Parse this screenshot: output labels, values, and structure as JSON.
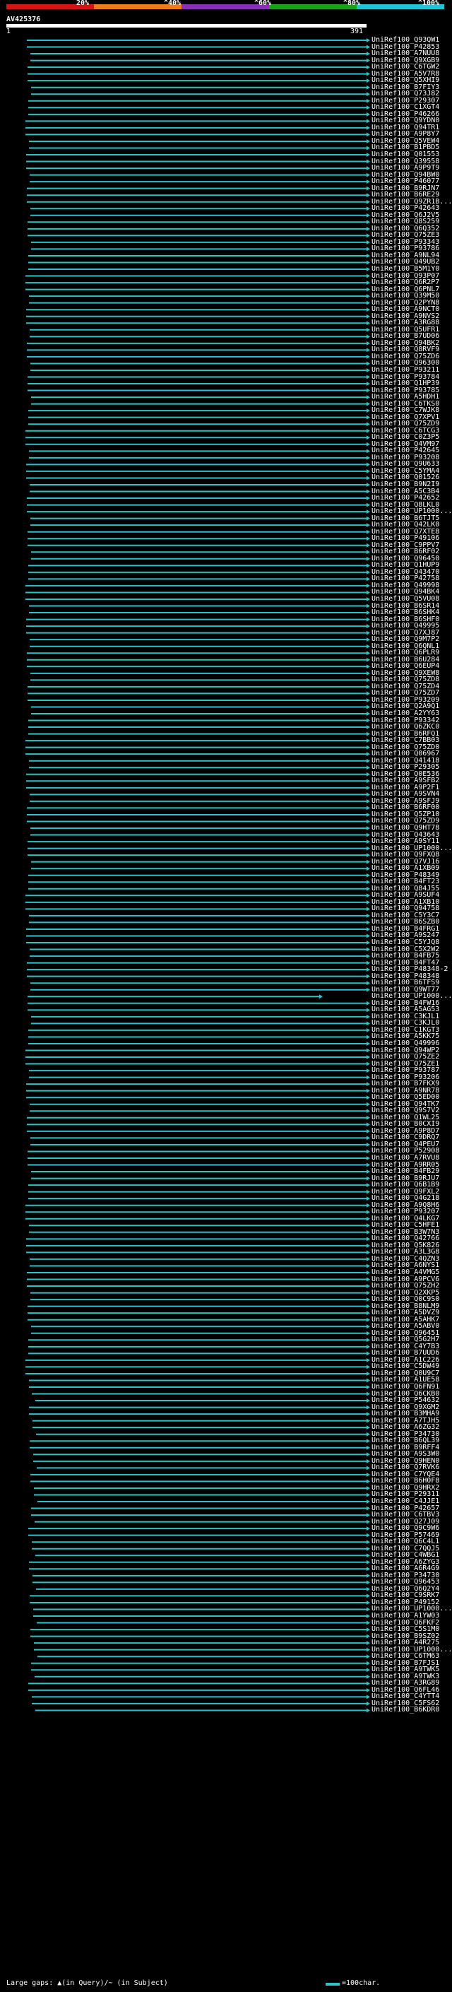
{
  "scale": {
    "labels": [
      "20%",
      "^40%",
      "^60%",
      "^80%",
      "^100%"
    ],
    "colors": [
      "#d61414",
      "#f07c1c",
      "#8a2fb8",
      "#1aa31a",
      "#21c3d9"
    ]
  },
  "query": {
    "title": "AV425376",
    "start": "1",
    "end": "391"
  },
  "hit_color": "#2bc3c8",
  "special_hit_color": "#2a9a1e",
  "hits": [
    "UniRef100_Q93QW1",
    "UniRef100_P42853",
    "UniRef100_A7NUU8",
    "UniRef100_Q9XGB9",
    "UniRef100_C6TGW2",
    "UniRef100_A5V7R8",
    "UniRef100_Q5XHI9",
    "UniRef100_B7FIY3",
    "UniRef100_Q73J82",
    "UniRef100_P29307",
    "UniRef100_C1XGT4",
    "UniRef100_P46266",
    "UniRef100_Q9YDN0",
    "UniRef100_Q94TR1",
    "UniRef100_A9P8Y7",
    "UniRef100_Q5VEW4",
    "UniRef100_B1PBD5",
    "UniRef100_Q01553",
    "UniRef100_Q39558",
    "UniRef100_A9P9T9",
    "UniRef100_Q94BW0",
    "UniRef100_P46077",
    "UniRef100_B9RJN7",
    "UniRef100_B6RE29",
    "UniRef100_Q9ZR1B...",
    "UniRef100_P42643",
    "UniRef100_Q6J2V5",
    "UniRef100_Q8S259",
    "UniRef100_Q6Q352",
    "UniRef100_Q75ZE3",
    "UniRef100_P93343",
    "UniRef100_P93786",
    "UniRef100_A9NL94",
    "UniRef100_Q49UB2",
    "UniRef100_B5M1Y0",
    "UniRef100_Q93P07",
    "UniRef100_Q6R2P7",
    "UniRef100_Q6PNL7",
    "UniRef100_Q39M50",
    "UniRef100_Q2PYN8",
    "UniRef100_A9NCT0",
    "UniRef100_A9NVS2",
    "UniRef100_A3RG88",
    "UniRef100_Q5UFR1",
    "UniRef100_B7UD06",
    "UniRef100_Q94BK2",
    "UniRef100_Q8RVF9",
    "UniRef100_Q75ZD6",
    "UniRef100_Q96300",
    "UniRef100_P93211",
    "UniRef100_P93784",
    "UniRef100_Q1HP39",
    "UniRef100_P93785",
    "UniRef100_A5HDH1",
    "UniRef100_C6TKS0",
    "UniRef100_C7WJK8",
    "UniRef100_Q7XPV1",
    "UniRef100_Q75ZD9",
    "UniRef100_C6TCG3",
    "UniRef100_C0Z3P5",
    "UniRef100_Q4VM97",
    "UniRef100_P42645",
    "UniRef100_P93208",
    "UniRef100_Q9U633",
    "UniRef100_C5YMA4",
    "UniRef100_Q01526",
    "UniRef100_B9N2I9",
    "UniRef100_A5C3B4",
    "UniRef100_P42652",
    "UniRef100_Q8LKL0",
    "UniRef100_UP1000...",
    "UniRef100_B6TJT5",
    "UniRef100_Q42LK0",
    "UniRef100_Q7XTE8",
    "UniRef100_P49106",
    "UniRef100_C9PPV7",
    "UniRef100_B6RF02",
    "UniRef100_Q96450",
    "UniRef100_Q1HUP9",
    "UniRef100_Q43470",
    "UniRef100_P42758",
    "UniRef100_Q49998",
    "UniRef100_Q94BK4",
    "UniRef100_Q5VU08",
    "UniRef100_B6SR14",
    "UniRef100_B6SHK4",
    "UniRef100_B6SHF0",
    "UniRef100_Q49995",
    "UniRef100_Q7XJ87",
    "UniRef100_Q9M7P2",
    "UniRef100_Q6QNL1",
    "UniRef100_Q6PLR9",
    "UniRef100_B6U284",
    "UniRef100_Q6EUP4",
    "UniRef100_Q9XEW8",
    "UniRef100_Q75ZD8",
    "UniRef100_Q75ZD4",
    "UniRef100_Q75ZD7",
    "UniRef100_P93209",
    "UniRef100_Q2A9Q1",
    "UniRef100_A2YY63",
    "UniRef100_P93342",
    "UniRef100_Q6ZKC0",
    "UniRef100_B6RFQ1",
    "UniRef100_C7BB03",
    "UniRef100_Q75ZD0",
    "UniRef100_Q06967",
    "UniRef100_Q41418",
    "UniRef100_P29305",
    "UniRef100_Q0E536",
    "UniRef100_A9SFB2",
    "UniRef100_A9P2F1",
    "UniRef100_A9SVN4",
    "UniRef100_A9SFJ9",
    "UniRef100_B6RF00",
    "UniRef100_Q5ZP10",
    "UniRef100_Q75ZD9",
    "UniRef100_Q9HT78",
    "UniRef100_Q43643",
    "UniRef100_A9SY11",
    "UniRef100_UP1000...",
    "UniRef100_Q9FXQ8",
    "UniRef100_Q7VJ16",
    "UniRef100_A1XB09",
    "UniRef100_P48349",
    "UniRef100_B4FT23",
    "UniRef100_Q84J55",
    "UniRef100_A9SUF4",
    "UniRef100_A1XB10",
    "UniRef100_Q94758",
    "UniRef100_C5Y3C7",
    "UniRef100_B6SZB0",
    "UniRef100_B4FRG1",
    "UniRef100_A9S247",
    "UniRef100_C5YJQ8",
    "UniRef100_C5X2W2",
    "UniRef100_B4FB75",
    "UniRef100_B4FT47",
    "UniRef100_P48348-2",
    "UniRef100_P48348",
    "UniRef100_B6TFS9",
    "UniRef100_Q9WT77",
    "UniRef100_UP1000...",
    "UniRef100_B4FW16",
    "UniRef100_A5AG53",
    "UniRef100_C3KJL1",
    "UniRef100_C3KJL0",
    "UniRef100_C1KGT3",
    "UniRef100_A5KK75",
    "UniRef100_Q49996",
    "UniRef100_Q94WP2",
    "UniRef100_Q75ZE2",
    "UniRef100_Q75ZE1",
    "UniRef100_P93787",
    "UniRef100_P93206",
    "UniRef100_B7FKX9",
    "UniRef100_A9NR78",
    "UniRef100_Q5ED00",
    "UniRef100_Q94TK7",
    "UniRef100_Q9S7V2",
    "UniRef100_Q1WL25",
    "UniRef100_B0CXI9",
    "UniRef100_A9P8D7",
    "UniRef100_C9DRQ7",
    "UniRef100_Q4PEU7",
    "UniRef100_P52908",
    "UniRef100_A7RVU8",
    "UniRef100_A9RR05",
    "UniRef100_B4FB29",
    "UniRef100_B9RJU7",
    "UniRef100_Q6B1B9",
    "UniRef100_Q9FXL2",
    "UniRef100_Q4G218",
    "UniRef100_A9Q8H6",
    "UniRef100_P93207",
    "UniRef100_Q4LKG7",
    "UniRef100_C5HFE1",
    "UniRef100_B3W7N3",
    "UniRef100_Q42766",
    "UniRef100_Q5K826",
    "UniRef100_A3L3G8",
    "UniRef100_C4QZN3",
    "UniRef100_A6NYS1",
    "UniRef100_A4VMG5",
    "UniRef100_A9PCV6",
    "UniRef100_Q75ZH2",
    "UniRef100_Q2XKP5",
    "UniRef100_Q0C9S0",
    "UniRef100_B8NLM9",
    "UniRef100_A5DVZ9",
    "UniRef100_A5AHK7",
    "UniRef100_A5ABV0",
    "UniRef100_Q96451",
    "UniRef100_Q5G2H7",
    "UniRef100_C4Y7B3",
    "UniRef100_B7UUD6",
    "UniRef100_A1C226",
    "UniRef100_C5DW49",
    "UniRef100_Q0U9C7",
    "UniRef100_A1UE58",
    "UniRef100_Q6FN91",
    "UniRef100_Q6CKB0",
    "UniRef100_P54632",
    "UniRef100_Q9XGM2",
    "UniRef100_B3MHA9",
    "UniRef100_A7TJH5",
    "UniRef100_A6ZG32",
    "UniRef100_P34730",
    "UniRef100_B6QL39",
    "UniRef100_B9RFF4",
    "UniRef100_A9S3W0",
    "UniRef100_Q9HEN0",
    "UniRef100_Q7RVK6",
    "UniRef100_C7YQE4",
    "UniRef100_B6H0F8",
    "UniRef100_Q9HRX2",
    "UniRef100_P29311",
    "UniRef100_C4JJE1",
    "UniRef100_P42657",
    "UniRef100_C6TBV3",
    "UniRef100_Q27J09",
    "UniRef100_Q9C9W6",
    "UniRef100_P57469",
    "UniRef100_Q6C4L1",
    "UniRef100_C7QQJ5",
    "UniRef100_C4WBG1",
    "UniRef100_A6ZYG3",
    "UniRef100_A6R4G9",
    "UniRef100_P34730",
    "UniRef100_Q96453",
    "UniRef100_Q6Q2Y4",
    "UniRef100_C9SRK7",
    "UniRef100_P49152",
    "UniRef100_UP1000...",
    "UniRef100_A1YW03",
    "UniRef100_Q6FKF2",
    "UniRef100_C5S1M0",
    "UniRef100_B9SZ02",
    "UniRef100_A4R275",
    "UniRef100_UP1000...",
    "UniRef100_C6TM63",
    "UniRef100_B7FJS1",
    "UniRef100_A9TWK5",
    "UniRef100_A9TWK3",
    "UniRef100_A3RG89",
    "UniRef100_Q6FL46",
    "UniRef100_C4YTT4",
    "UniRef100_C5FS62",
    "UniRef100_B6KDR0"
  ],
  "legend": {
    "gaps_text": "Large gaps: ▲(in Query)/~ (in Subject)",
    "scale_text": "=100char."
  }
}
